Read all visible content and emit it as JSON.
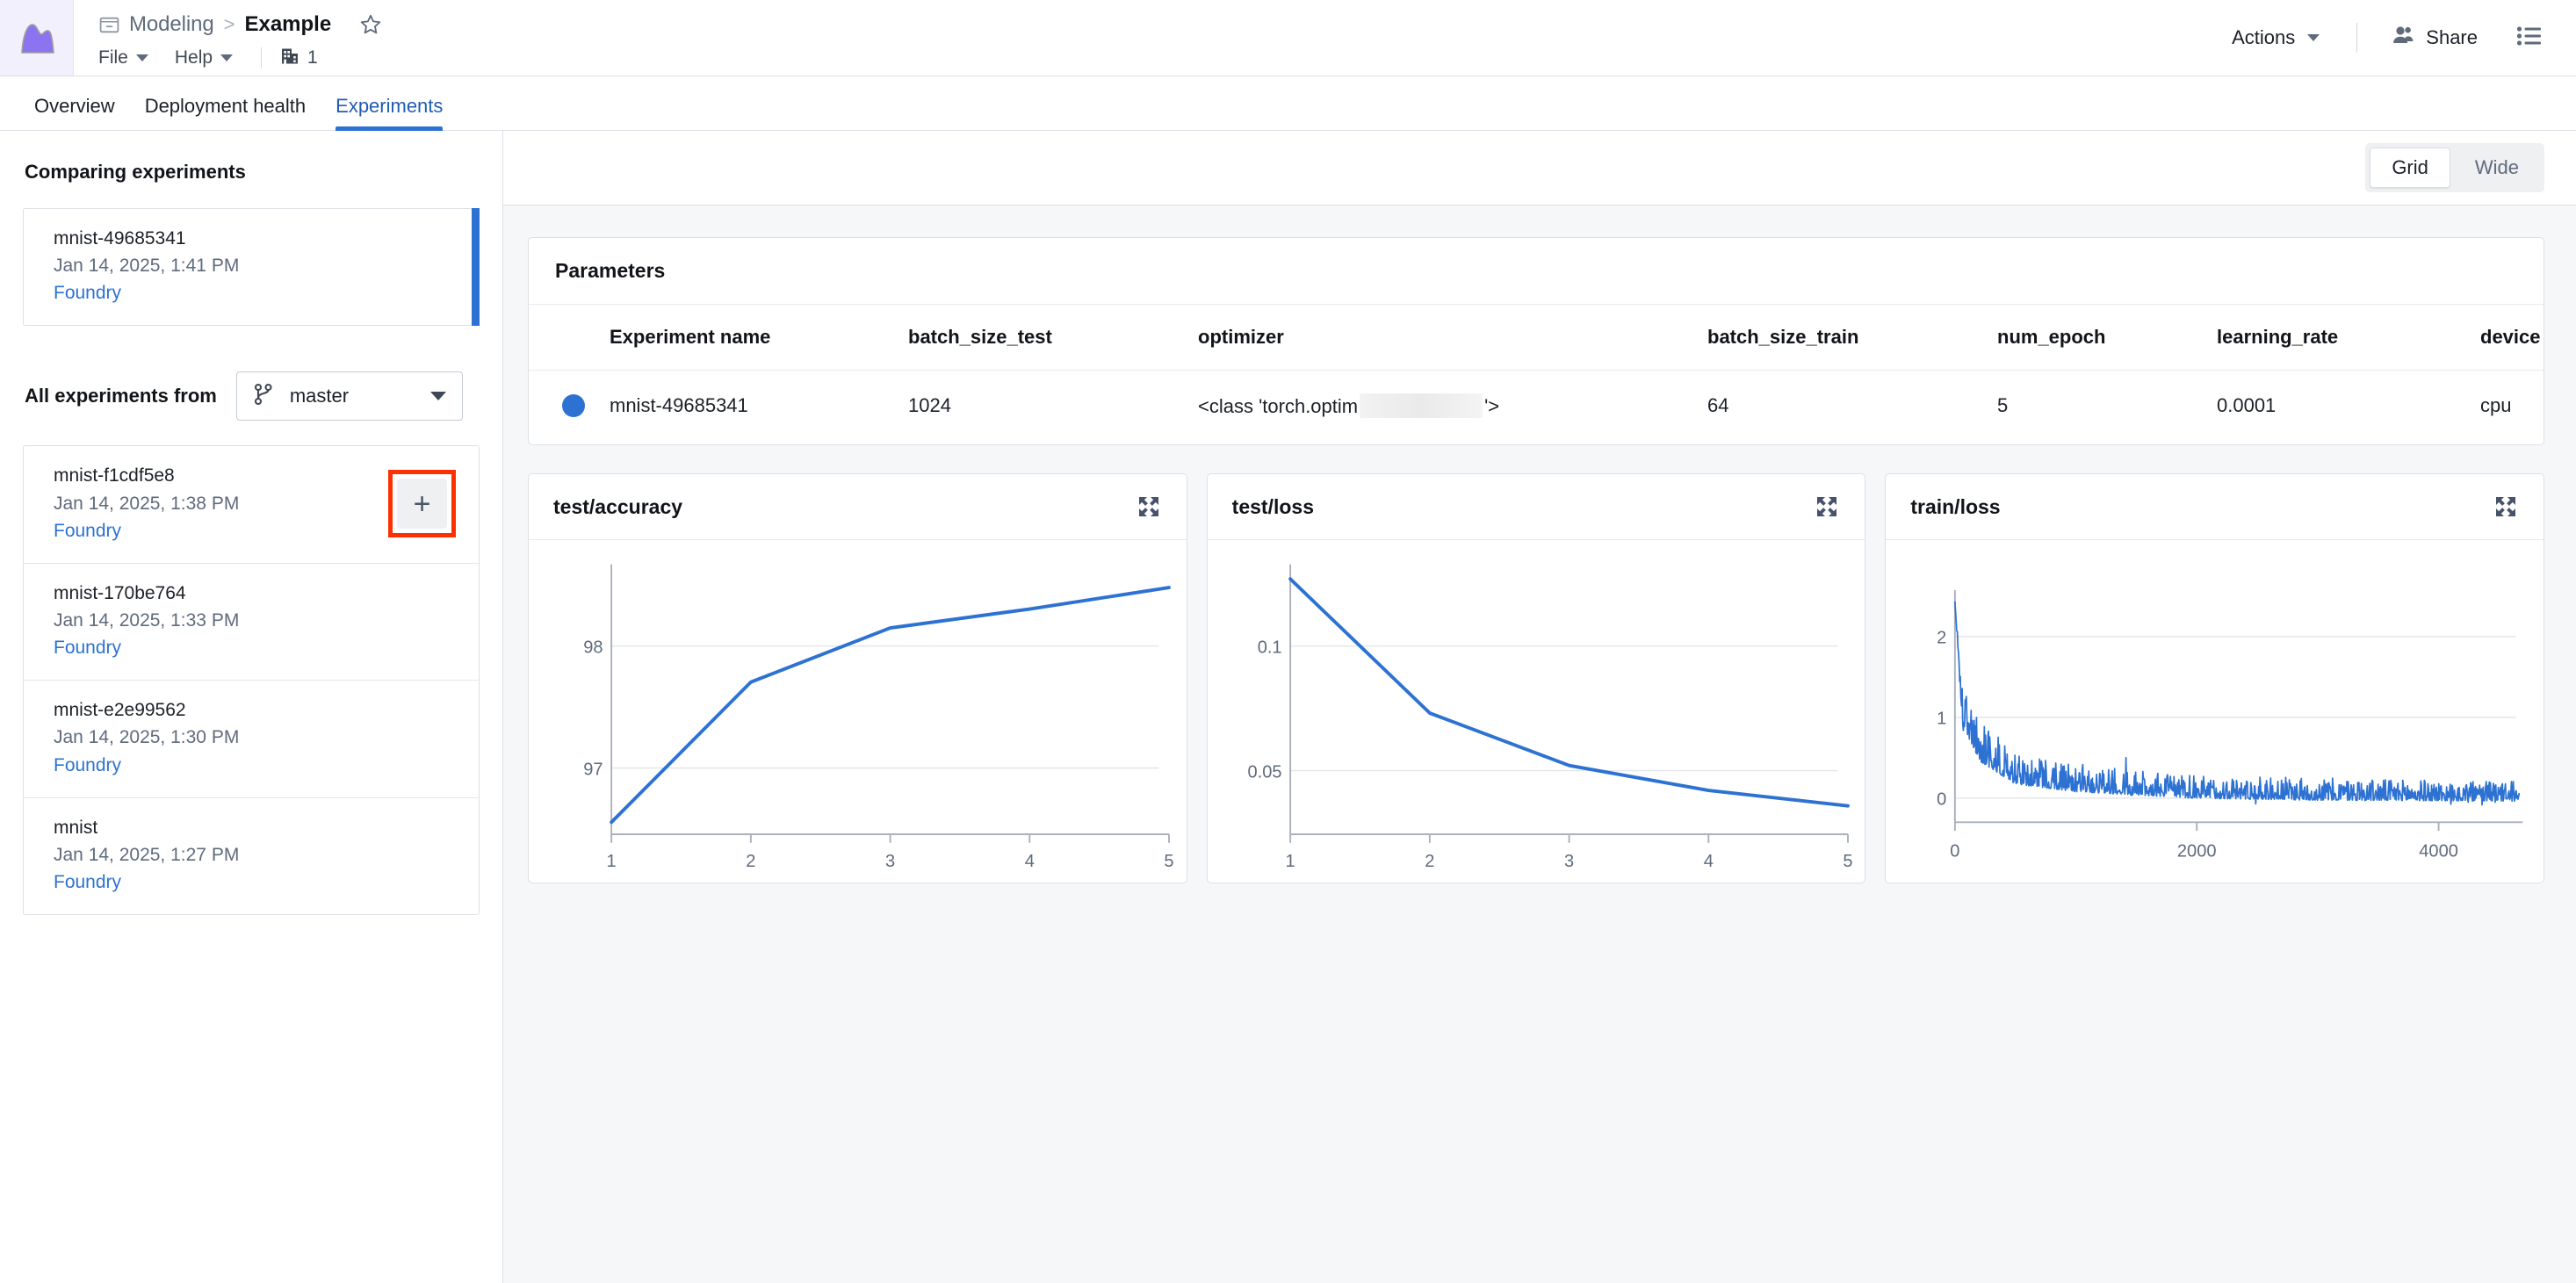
{
  "topbar": {
    "logo_icon": "mountain-chart-logo",
    "breadcrumb": {
      "folder_icon": "folder-icon",
      "parent": "Modeling",
      "separator": ">",
      "current": "Example",
      "star_icon": "star-icon"
    },
    "menus": [
      {
        "label": "File",
        "icon": "chevron-down-icon"
      },
      {
        "label": "Help",
        "icon": "chevron-down-icon"
      }
    ],
    "org": {
      "icon": "building-icon",
      "count": "1"
    },
    "actions_label": "Actions",
    "actions_icon": "chevron-down-icon",
    "share_label": "Share",
    "share_icon": "people-icon",
    "list_icon": "list-detail-icon"
  },
  "tabs": [
    {
      "label": "Overview",
      "active": false
    },
    {
      "label": "Deployment health",
      "active": false
    },
    {
      "label": "Experiments",
      "active": true
    }
  ],
  "sidebar": {
    "comparing_heading": "Comparing experiments",
    "compared": [
      {
        "name": "mnist-49685341",
        "date": "Jan 14, 2025, 1:41 PM",
        "source": "Foundry"
      }
    ],
    "all_label": "All experiments from",
    "branch": {
      "icon": "git-branch-icon",
      "value": "master",
      "caret_icon": "chevron-down-icon"
    },
    "add_button_icon": "plus-icon",
    "experiments": [
      {
        "name": "mnist-f1cdf5e8",
        "date": "Jan 14, 2025, 1:38 PM",
        "source": "Foundry",
        "has_add": true
      },
      {
        "name": "mnist-170be764",
        "date": "Jan 14, 2025, 1:33 PM",
        "source": "Foundry",
        "has_add": false
      },
      {
        "name": "mnist-e2e99562",
        "date": "Jan 14, 2025, 1:30 PM",
        "source": "Foundry",
        "has_add": false
      },
      {
        "name": "mnist",
        "date": "Jan 14, 2025, 1:27 PM",
        "source": "Foundry",
        "has_add": false
      }
    ]
  },
  "main": {
    "view_modes": [
      {
        "label": "Grid",
        "active": true
      },
      {
        "label": "Wide",
        "active": false
      }
    ],
    "parameters": {
      "title": "Parameters",
      "columns": [
        "Experiment name",
        "batch_size_test",
        "optimizer",
        "batch_size_train",
        "num_epoch",
        "learning_rate",
        "device"
      ],
      "rows": [
        {
          "dot_color": "#2d72d2",
          "name": "mnist-49685341",
          "batch_size_test": "1024",
          "optimizer_prefix": "<class 'torch.optim",
          "optimizer_suffix": "'>",
          "batch_size_train": "64",
          "num_epoch": "5",
          "learning_rate": "0.0001",
          "device": "cpu"
        }
      ]
    }
  },
  "colors": {
    "accent_blue": "#2d72d2",
    "link_blue": "#2d72d2",
    "highlight_red": "#fb3102",
    "logo_purple": "#8c73f0",
    "text_dark": "#1c2127",
    "text_muted": "#5f6b7c",
    "border": "#dce0e5",
    "panel_bg": "#f6f7f9"
  },
  "chart_data": [
    {
      "type": "line",
      "title": "test/accuracy",
      "expand_icon": "expand-icon",
      "x": [
        1,
        2,
        3,
        4,
        5
      ],
      "values": [
        96.4,
        97.75,
        98.35,
        98.57,
        98.78
      ],
      "xlabel": "",
      "ylabel": "",
      "xticks": [
        "1",
        "2",
        "3",
        "4",
        "5"
      ],
      "yticks": [
        "97",
        "98"
      ],
      "ytick_values": [
        97,
        98
      ],
      "xlim": [
        1,
        5
      ],
      "ylim": [
        96.25,
        98.95
      ],
      "grid": true,
      "legend": "none",
      "series_color": "#2d72d2"
    },
    {
      "type": "line",
      "title": "test/loss",
      "expand_icon": "expand-icon",
      "x": [
        1,
        2,
        3,
        4,
        5
      ],
      "values": [
        0.127,
        0.0715,
        0.0515,
        0.0425,
        0.0375
      ],
      "xlabel": "",
      "ylabel": "",
      "xticks": [
        "1",
        "2",
        "3",
        "4",
        "5"
      ],
      "yticks": [
        "0.05",
        "0.1"
      ],
      "ytick_values": [
        0.05,
        0.1
      ],
      "xlim": [
        1,
        5
      ],
      "ylim": [
        0.034,
        0.1315
      ],
      "grid": true,
      "legend": "none",
      "series_color": "#2d72d2"
    },
    {
      "type": "line",
      "title": "train/loss",
      "expand_icon": "expand-icon",
      "note": "noisy per-step training loss, ~4700 steps",
      "x_range": [
        0,
        4690
      ],
      "xticks": [
        "0",
        "2000",
        "4000"
      ],
      "xtick_values": [
        0,
        2000,
        4000
      ],
      "yticks": [
        "0",
        "1",
        "2"
      ],
      "ytick_values": [
        0,
        1,
        2
      ],
      "xlim": [
        0,
        4690
      ],
      "ylim": [
        -0.18,
        2.32
      ],
      "peak_value": 2.2,
      "decay_envelope": [
        {
          "step": 0,
          "mean": 2.2,
          "spread": 0.0
        },
        {
          "step": 60,
          "mean": 1.0,
          "spread": 0.25
        },
        {
          "step": 200,
          "mean": 0.62,
          "spread": 0.3
        },
        {
          "step": 500,
          "mean": 0.33,
          "spread": 0.22
        },
        {
          "step": 1000,
          "mean": 0.24,
          "spread": 0.2
        },
        {
          "step": 2000,
          "mean": 0.15,
          "spread": 0.16
        },
        {
          "step": 3000,
          "mean": 0.13,
          "spread": 0.16
        },
        {
          "step": 4690,
          "mean": 0.11,
          "spread": 0.14
        }
      ],
      "grid": true,
      "legend": "none",
      "series_color": "#2d72d2"
    }
  ]
}
